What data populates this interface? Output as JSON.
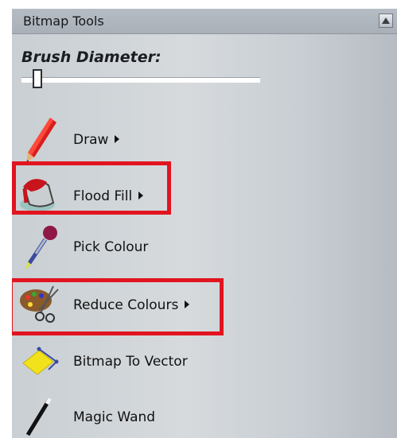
{
  "panel": {
    "title": "Bitmap Tools",
    "collapse_icon": "triangle-up-icon"
  },
  "brush": {
    "label": "Brush Diameter:",
    "value": 0.05
  },
  "tools": [
    {
      "label": "Draw",
      "has_submenu": true,
      "icon": "pencil-icon",
      "highlighted": false
    },
    {
      "label": "Flood Fill",
      "has_submenu": true,
      "icon": "paint-bucket-icon",
      "highlighted": true
    },
    {
      "label": "Pick Colour",
      "has_submenu": false,
      "icon": "eyedropper-icon",
      "highlighted": false
    },
    {
      "label": "Reduce Colours",
      "has_submenu": true,
      "icon": "palette-scissors-icon",
      "highlighted": true
    },
    {
      "label": "Bitmap To Vector",
      "has_submenu": false,
      "icon": "bitmap-to-vector-icon",
      "highlighted": false
    },
    {
      "label": "Magic Wand",
      "has_submenu": false,
      "icon": "magic-wand-icon",
      "highlighted": false
    }
  ],
  "colors": {
    "highlight": "#e1141f",
    "panel_bg": "#d6dadd",
    "header_bg": "#b0b7be"
  }
}
